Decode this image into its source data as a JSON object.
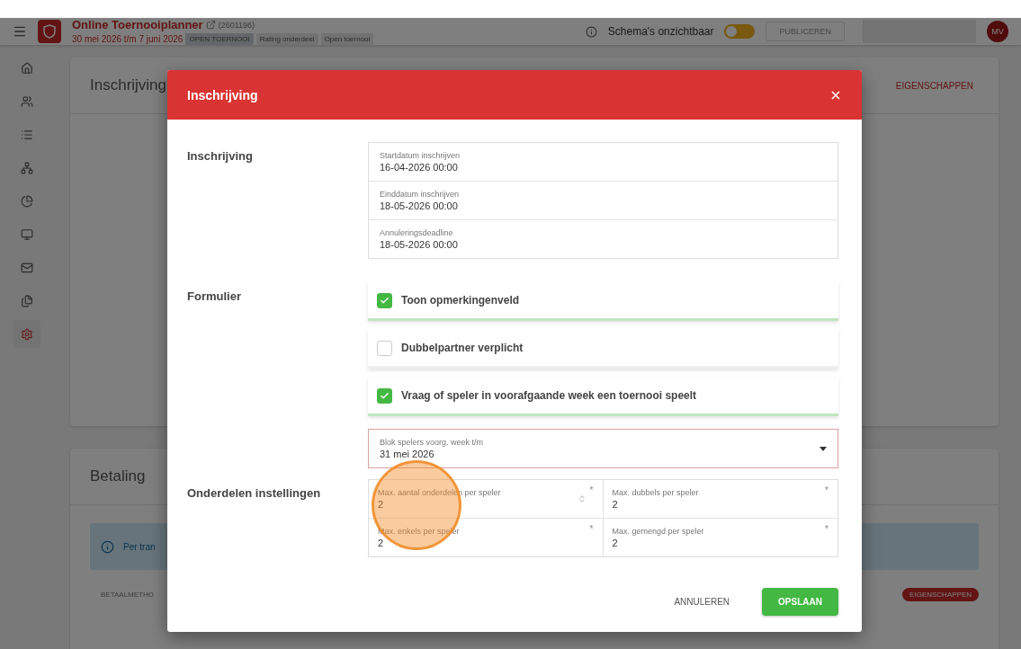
{
  "app_header": {
    "title": "Online Toernooiplanner",
    "tournament_id": "(2601196)",
    "dates": "30 mei 2026 t/m 7 juni 2026",
    "badges": [
      "OPEN TOERNOOI",
      "Rating onderdeel",
      "Open toernooi"
    ],
    "visibility_label": "Schema's onzichtbaar",
    "visibility_toggle": {
      "on": false
    },
    "publish_button": "PUBLICEREN",
    "avatar": "MV"
  },
  "sidebar": {
    "items": [
      {
        "kind": "home",
        "selected": false
      },
      {
        "kind": "users",
        "selected": false
      },
      {
        "kind": "list",
        "selected": false
      },
      {
        "kind": "tree",
        "selected": false
      },
      {
        "kind": "pie",
        "selected": false
      },
      {
        "kind": "monitor",
        "selected": false
      },
      {
        "kind": "mail",
        "selected": false
      },
      {
        "kind": "files",
        "selected": false
      },
      {
        "kind": "settings",
        "selected": true
      }
    ]
  },
  "registration_card": {
    "title": "Inschrijving",
    "action": "EIGENSCHAPPEN"
  },
  "payment_card": {
    "title": "Betaling",
    "info": "Per tran",
    "column_1": "BETAALMETHO",
    "action": "EIGENSCHAPPEN"
  },
  "dialog": {
    "title": "Inschrijving",
    "registration": {
      "label": "Inschrijving",
      "fields": [
        {
          "label": "Startdatum inschrijven",
          "value": "16-04-2026 00:00"
        },
        {
          "label": "Einddatum inschrijven",
          "value": "18-05-2026 00:00"
        },
        {
          "label": "Annuleringsdeadline",
          "value": "18-05-2026 00:00"
        }
      ]
    },
    "form": {
      "label": "Formulier",
      "options": [
        {
          "label": "Toon opmerkingenveld",
          "checked": true
        },
        {
          "label": "Dubbelpartner verplicht",
          "checked": false
        },
        {
          "label": "Vraag of speler in voorafgaande week een toernooi speelt",
          "checked": true
        }
      ],
      "select": {
        "label": "Blok spelers voorg. week t/m",
        "value": "31 mei 2026"
      }
    },
    "events": {
      "label": "Onderdelen instellingen",
      "fields": [
        {
          "label": "Max. aantal onderdelen per speler",
          "value": "2",
          "required_mark": "*",
          "spinner": true
        },
        {
          "label": "Max. dubbels per speler",
          "value": "2",
          "required_mark": "*",
          "spinner": false
        },
        {
          "label": "Max. enkels per speler",
          "value": "2",
          "required_mark": "*",
          "spinner": false
        },
        {
          "label": "Max. gemengd per speler",
          "value": "2",
          "required_mark": "*",
          "spinner": false
        }
      ]
    },
    "buttons": {
      "cancel": "ANNULEREN",
      "save": "OPSLAAN"
    }
  }
}
